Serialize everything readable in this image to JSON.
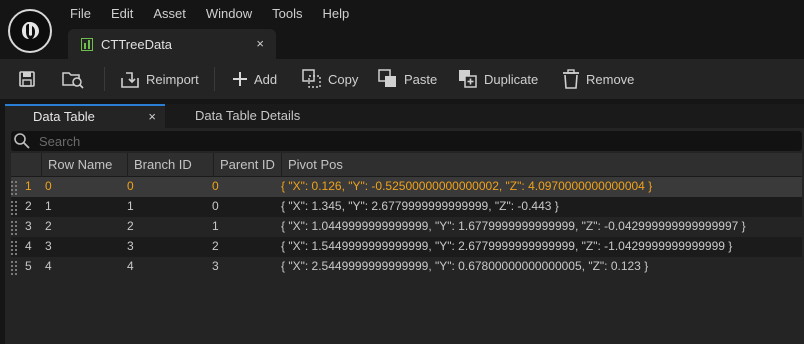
{
  "menu": [
    "File",
    "Edit",
    "Asset",
    "Window",
    "Tools",
    "Help"
  ],
  "document_tab": {
    "label": "CTTreeData",
    "close": "×"
  },
  "toolbar": {
    "reimport": "Reimport",
    "add": "Add",
    "copy": "Copy",
    "paste": "Paste",
    "duplicate": "Duplicate",
    "remove": "Remove"
  },
  "panel_tabs": {
    "data_table": "Data Table",
    "close": "×",
    "details": "Data Table Details"
  },
  "search": {
    "placeholder": "Search"
  },
  "table": {
    "columns": [
      "Row Name",
      "Branch ID",
      "Parent ID",
      "Pivot Pos"
    ],
    "rows": [
      {
        "index": "1",
        "row_name": "0",
        "branch_id": "0",
        "parent_id": "0",
        "pivot_pos": "{ \"X\": 0.126, \"Y\": -0.52500000000000002, \"Z\": 4.0970000000000004 }"
      },
      {
        "index": "2",
        "row_name": "1",
        "branch_id": "1",
        "parent_id": "0",
        "pivot_pos": "{ \"X\": 1.345, \"Y\": 2.6779999999999999, \"Z\": -0.443 }"
      },
      {
        "index": "3",
        "row_name": "2",
        "branch_id": "2",
        "parent_id": "1",
        "pivot_pos": "{ \"X\": 1.0449999999999999, \"Y\": 1.6779999999999999, \"Z\": -0.042999999999999997 }"
      },
      {
        "index": "4",
        "row_name": "3",
        "branch_id": "3",
        "parent_id": "2",
        "pivot_pos": "{ \"X\": 1.5449999999999999, \"Y\": 2.6779999999999999, \"Z\": -1.0429999999999999 }"
      },
      {
        "index": "5",
        "row_name": "4",
        "branch_id": "4",
        "parent_id": "3",
        "pivot_pos": "{ \"X\": 2.5449999999999999, \"Y\": 0.67800000000000005, \"Z\": 0.123 }"
      }
    ]
  },
  "colors": {
    "selected_text": "#f0a21a",
    "active_tab_accent": "#2a7fd4",
    "datatable_icon": "#6bbf4a"
  }
}
